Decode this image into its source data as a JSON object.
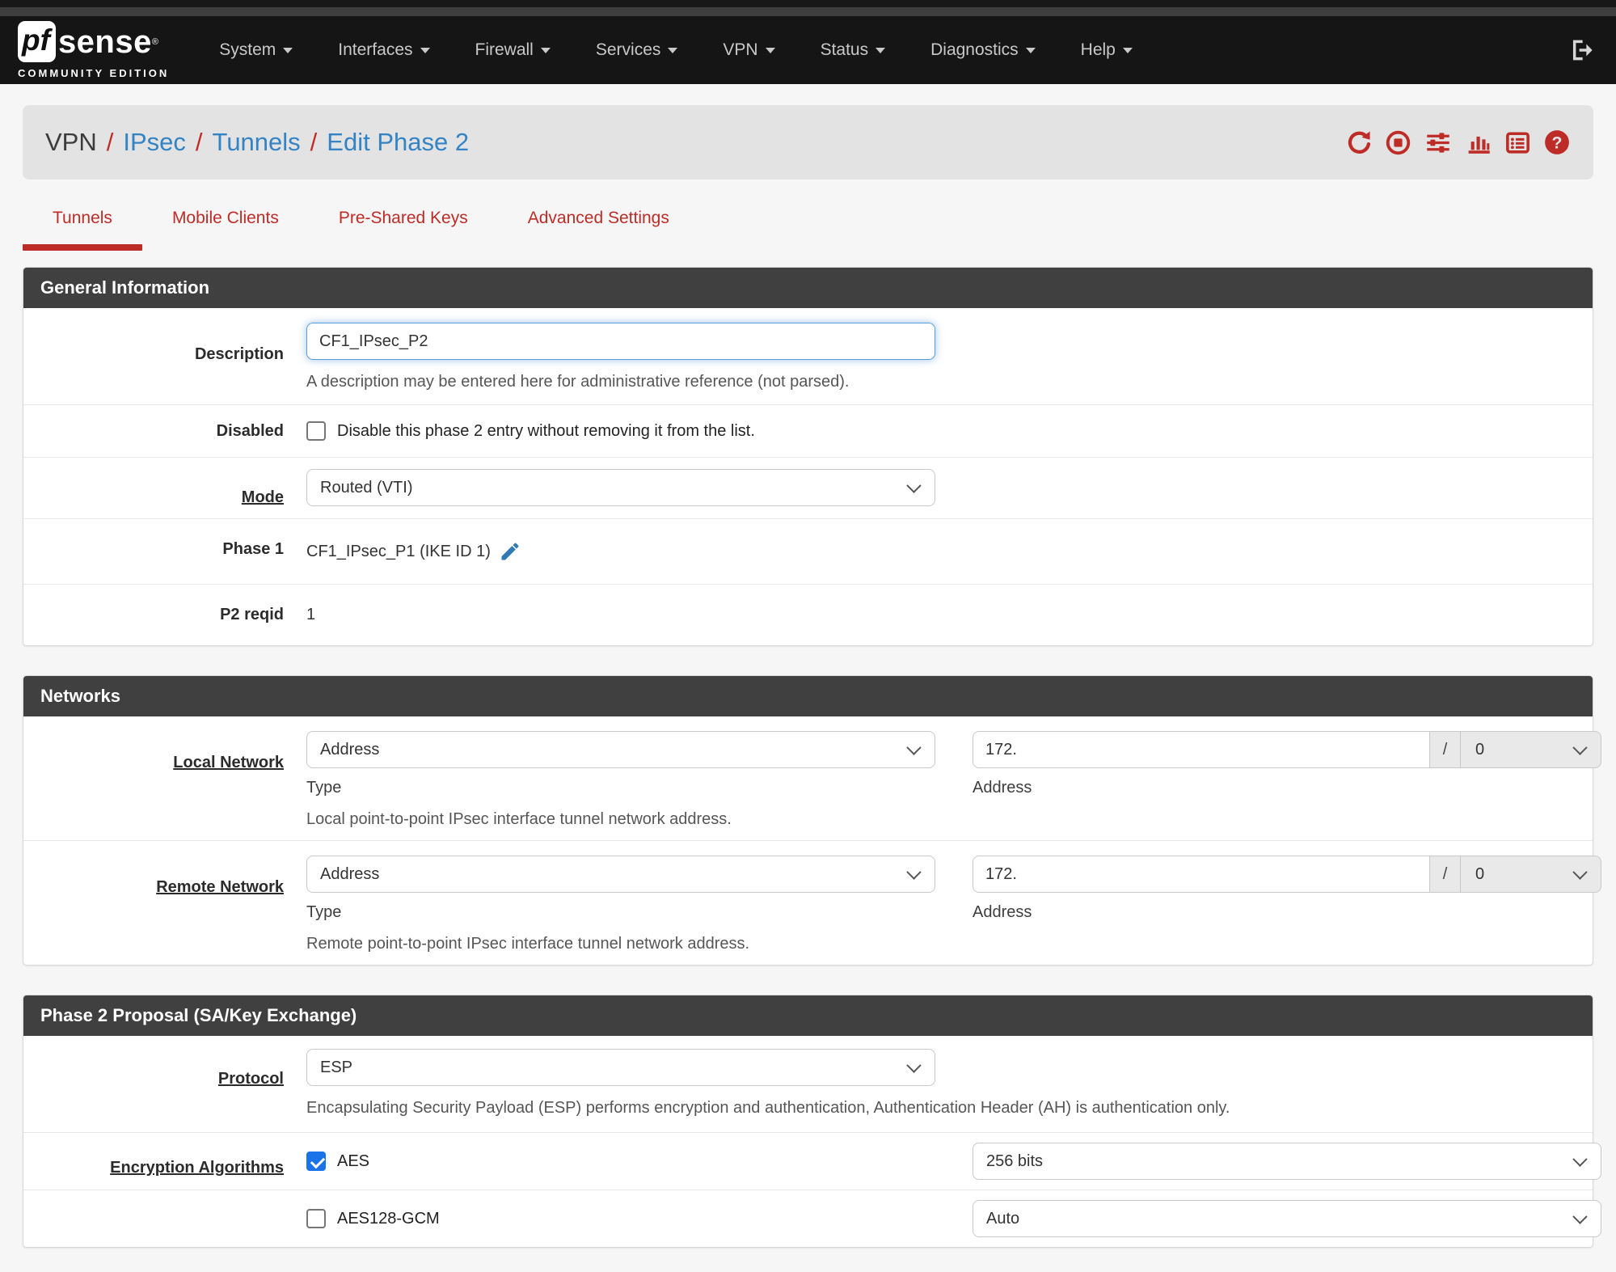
{
  "colors": {
    "accent_red": "#bd2c27",
    "link_blue": "#3383c5",
    "checkbox_blue": "#1a73e8",
    "header_gray": "#404040"
  },
  "navbar": {
    "logo": {
      "pf": "pf",
      "sense": "sense",
      "registered": "®",
      "edition": "COMMUNITY EDITION"
    },
    "items": [
      {
        "label": "System"
      },
      {
        "label": "Interfaces"
      },
      {
        "label": "Firewall"
      },
      {
        "label": "Services"
      },
      {
        "label": "VPN"
      },
      {
        "label": "Status"
      },
      {
        "label": "Diagnostics"
      },
      {
        "label": "Help"
      }
    ],
    "logout_icon": "sign-out-icon"
  },
  "breadcrumb": {
    "separator": "/",
    "items": [
      {
        "label": "VPN",
        "link": false
      },
      {
        "label": "IPsec",
        "link": true
      },
      {
        "label": "Tunnels",
        "link": true
      },
      {
        "label": "Edit Phase 2",
        "link": true
      }
    ],
    "action_icons": [
      "refresh-icon",
      "stop-circle-icon",
      "sliders-icon",
      "bar-chart-icon",
      "log-list-icon",
      "help-icon"
    ]
  },
  "tabs": [
    {
      "label": "Tunnels",
      "active": true
    },
    {
      "label": "Mobile Clients",
      "active": false
    },
    {
      "label": "Pre-Shared Keys",
      "active": false
    },
    {
      "label": "Advanced Settings",
      "active": false
    }
  ],
  "general": {
    "title": "General Information",
    "description": {
      "label": "Description",
      "value": "CF1_IPsec_P2",
      "help": "A description may be entered here for administrative reference (not parsed)."
    },
    "disabled": {
      "label": "Disabled",
      "checkbox_label": "Disable this phase 2 entry without removing it from the list.",
      "checked": false
    },
    "mode": {
      "label": "Mode",
      "value": "Routed (VTI)"
    },
    "phase1": {
      "label": "Phase 1",
      "value": "CF1_IPsec_P1 (IKE ID 1)",
      "edit_icon": "pencil-icon"
    },
    "p2reqid": {
      "label": "P2 reqid",
      "value": "1"
    }
  },
  "networks": {
    "title": "Networks",
    "local": {
      "label": "Local Network",
      "type_value": "Address",
      "type_sublabel": "Type",
      "address_value": "172.",
      "address_sublabel": "Address",
      "cidr_separator": "/",
      "cidr_value": "0",
      "help": "Local point-to-point IPsec interface tunnel network address."
    },
    "remote": {
      "label": "Remote Network",
      "type_value": "Address",
      "type_sublabel": "Type",
      "address_value": "172.",
      "address_sublabel": "Address",
      "cidr_separator": "/",
      "cidr_value": "0",
      "help": "Remote point-to-point IPsec interface tunnel network address."
    }
  },
  "proposal": {
    "title": "Phase 2 Proposal (SA/Key Exchange)",
    "protocol": {
      "label": "Protocol",
      "value": "ESP",
      "help": "Encapsulating Security Payload (ESP) performs encryption and authentication, Authentication Header (AH) is authentication only."
    },
    "encryption": {
      "label": "Encryption Algorithms",
      "algorithms": [
        {
          "name": "AES",
          "checked": true,
          "key_length": "256 bits"
        },
        {
          "name": "AES128-GCM",
          "checked": false,
          "key_length": "Auto"
        }
      ]
    }
  }
}
